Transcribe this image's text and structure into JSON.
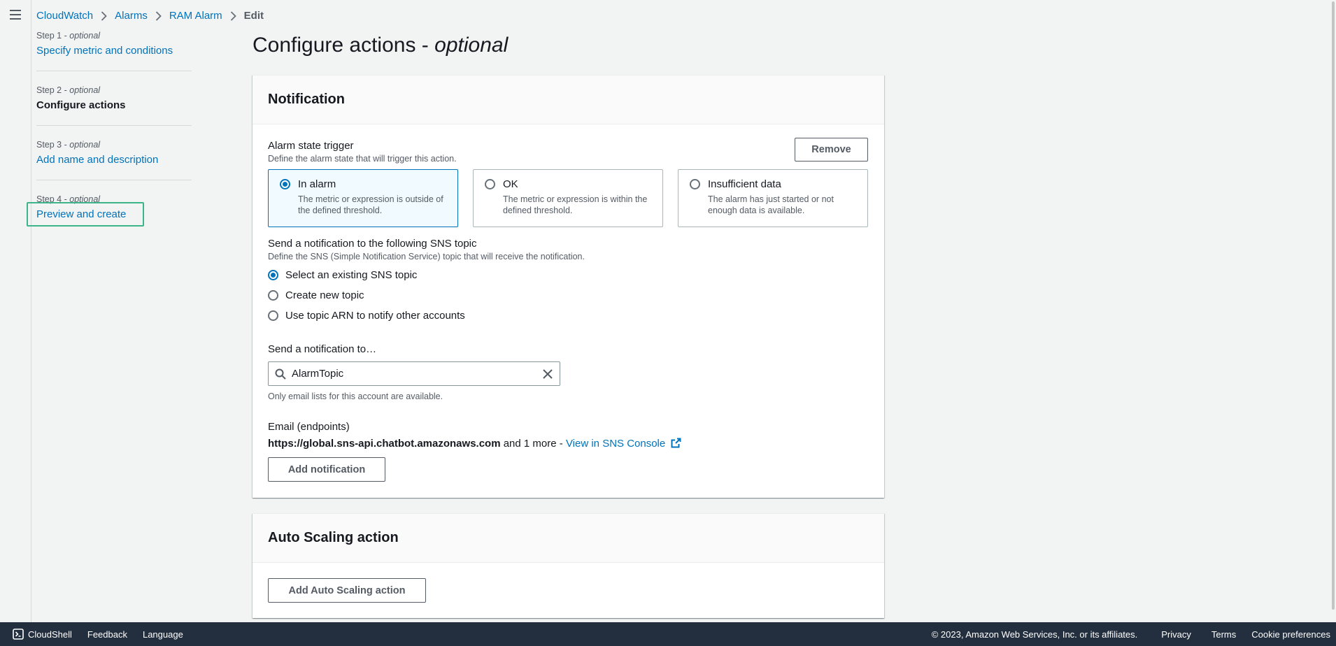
{
  "breadcrumb": {
    "items": [
      "CloudWatch",
      "Alarms",
      "RAM Alarm"
    ],
    "current": "Edit"
  },
  "steps": [
    {
      "num": "Step 1 -",
      "opt": "optional",
      "label": "Specify metric and conditions"
    },
    {
      "num": "Step 2 -",
      "opt": "optional",
      "label": "Configure actions"
    },
    {
      "num": "Step 3 -",
      "opt": "optional",
      "label": "Add name and description"
    },
    {
      "num": "Step 4 -",
      "opt": "optional",
      "label": "Preview and create"
    }
  ],
  "page": {
    "title": "Configure actions - ",
    "title_italic": "optional"
  },
  "notification": {
    "header": "Notification",
    "trigger_label": "Alarm state trigger",
    "trigger_desc": "Define the alarm state that will trigger this action.",
    "remove_label": "Remove",
    "tiles": [
      {
        "title": "In alarm",
        "desc": "The metric or expression is outside of the defined threshold.",
        "selected": true
      },
      {
        "title": "OK",
        "desc": "The metric or expression is within the defined threshold.",
        "selected": false
      },
      {
        "title": "Insufficient data",
        "desc": "The alarm has just started or not enough data is available.",
        "selected": false
      }
    ],
    "sns_label": "Send a notification to the following SNS topic",
    "sns_desc": "Define the SNS (Simple Notification Service) topic that will receive the notification.",
    "sns_options": [
      {
        "label": "Select an existing SNS topic",
        "selected": true
      },
      {
        "label": "Create new topic",
        "selected": false
      },
      {
        "label": "Use topic ARN to notify other accounts",
        "selected": false
      }
    ],
    "send_to_label": "Send a notification to…",
    "search_value": "AlarmTopic",
    "search_hint": "Only email lists for this account are available.",
    "email_label": "Email (endpoints)",
    "email_endpoint": "https://global.sns-api.chatbot.amazonaws.com",
    "email_more": " and 1 more - ",
    "view_console": "View in SNS Console",
    "add_notification": "Add notification"
  },
  "autoscaling": {
    "header": "Auto Scaling action",
    "add_label": "Add Auto Scaling action"
  },
  "footer": {
    "cloudshell": "CloudShell",
    "feedback": "Feedback",
    "language": "Language",
    "copyright": "© 2023, Amazon Web Services, Inc. or its affiliates.",
    "privacy": "Privacy",
    "terms": "Terms",
    "cookies": "Cookie preferences"
  },
  "colors": {
    "accent": "#0073bb",
    "highlight": "#3eb489",
    "footer_bg": "#232f3e"
  }
}
